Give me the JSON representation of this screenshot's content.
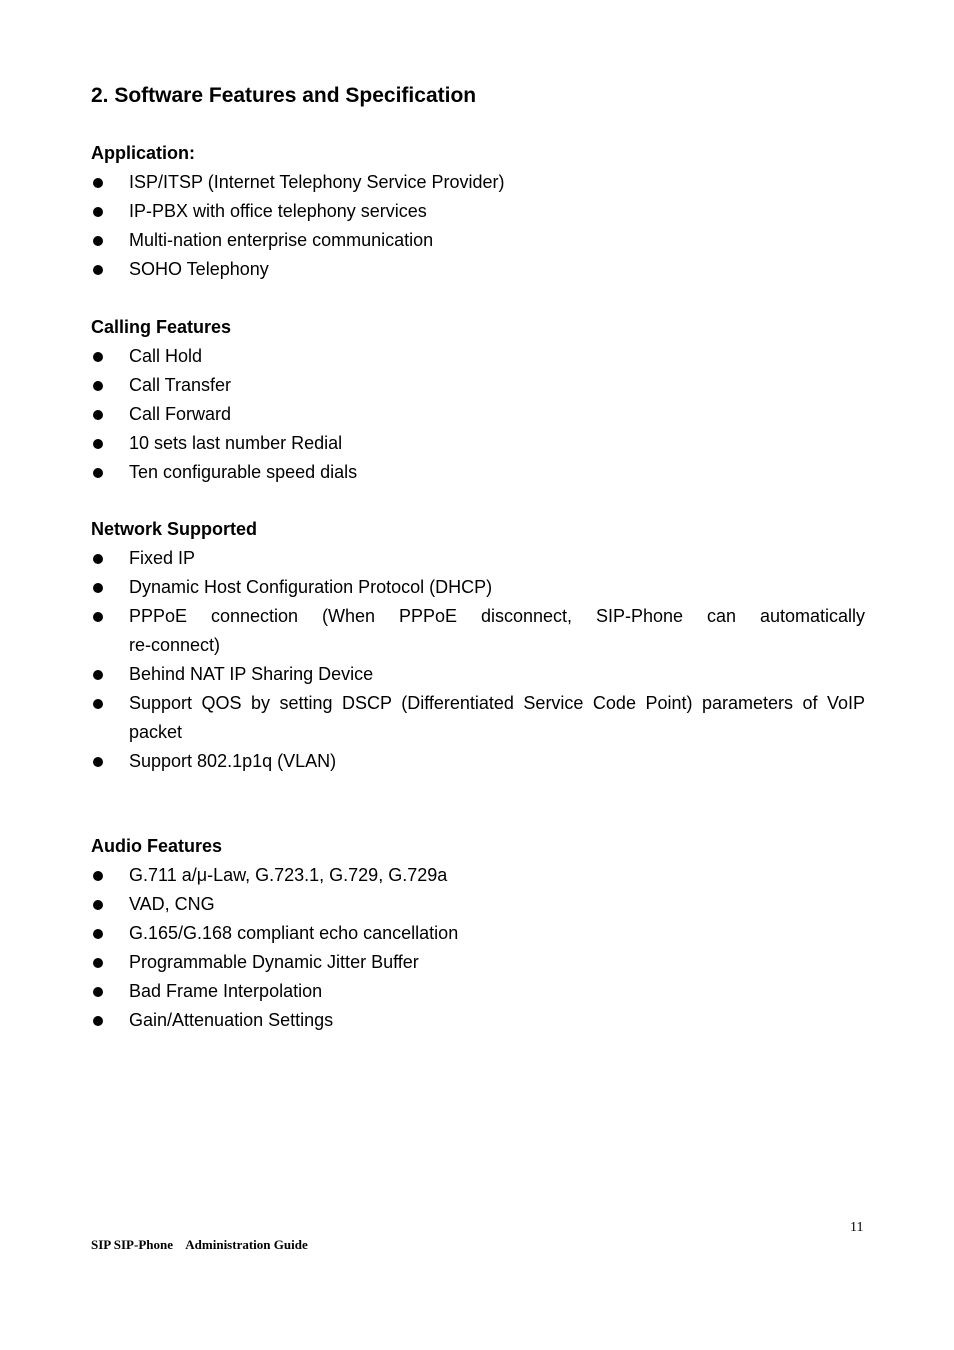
{
  "page": {
    "title": "2. Software Features and Specification",
    "sections": [
      {
        "heading": "Application:",
        "items": [
          "ISP/ITSP (Internet Telephony Service Provider)",
          "IP-PBX with office telephony services",
          "Multi-nation enterprise communication",
          "SOHO Telephony"
        ]
      },
      {
        "heading": "Calling Features",
        "items": [
          "Call Hold",
          "Call Transfer",
          "Call Forward",
          "10 sets last number Redial",
          "Ten configurable speed dials"
        ]
      },
      {
        "heading": "Network Supported",
        "items": [
          "Fixed IP",
          "Dynamic Host Configuration Protocol (DHCP)",
          "PPPoE connection (When PPPoE disconnect, SIP-Phone can automatically re-connect)",
          "Behind NAT IP Sharing Device",
          "Support QOS by setting DSCP (Differentiated Service Code Point) parameters of VoIP packet",
          "Support 802.1p1q (VLAN)"
        ]
      },
      {
        "heading": "Audio Features",
        "items": [
          "G.711 a/μ-Law, G.723.1, G.729, G.729a",
          "VAD, CNG",
          "G.165/G.168 compliant echo cancellation",
          "Programmable Dynamic Jitter Buffer",
          "Bad Frame Interpolation",
          "Gain/Attenuation Settings"
        ]
      }
    ],
    "footer": {
      "title": "SIP SIP-Phone    Administration Guide",
      "page_number": "11"
    }
  }
}
